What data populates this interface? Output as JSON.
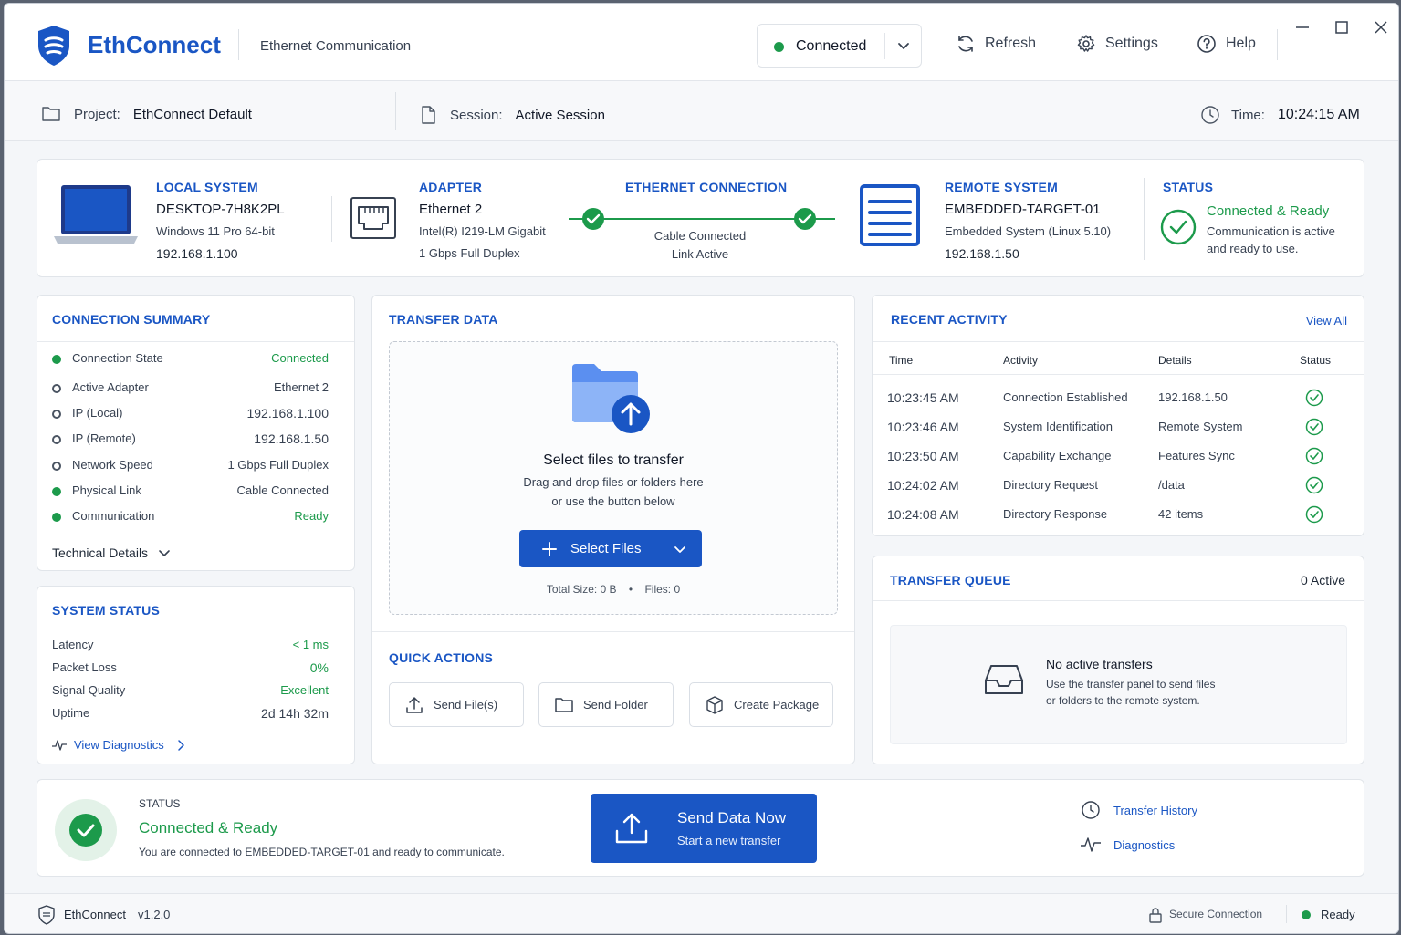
{
  "app": {
    "name": "EthConnect",
    "subtitle": "Ethernet Communication",
    "version": "v1.2.0"
  },
  "toolbar": {
    "connection_state": "Connected",
    "refresh": "Refresh",
    "settings": "Settings",
    "help": "Help"
  },
  "infobar": {
    "project_label": "Project:",
    "project": "EthConnect Default",
    "session_label": "Session:",
    "session": "Active Session",
    "time_label": "Time:",
    "time": "10:24:15 AM"
  },
  "overview": {
    "local": {
      "title": "LOCAL SYSTEM",
      "name": "DESKTOP-7H8K2PL",
      "os": "Windows 11 Pro 64-bit",
      "ip": "192.168.1.100"
    },
    "adapter": {
      "title": "ADAPTER",
      "name": "Ethernet 2",
      "model": "Intel(R) I219-LM Gigabit",
      "speed": "1 Gbps Full Duplex"
    },
    "link": {
      "title": "ETHERNET CONNECTION",
      "cable": "Cable Connected",
      "state": "Link Active"
    },
    "remote": {
      "title": "REMOTE SYSTEM",
      "name": "EMBEDDED-TARGET-01",
      "os": "Embedded System (Linux 5.10)",
      "ip": "192.168.1.50"
    },
    "status": {
      "title": "STATUS",
      "state": "Connected & Ready",
      "line1": "Communication is active",
      "line2": "and ready to use."
    }
  },
  "summary": {
    "title": "CONNECTION SUMMARY",
    "rows": [
      {
        "label": "Connection State",
        "value": "Connected"
      },
      {
        "label": "Active Adapter",
        "value": "Ethernet 2"
      },
      {
        "label": "IP (Local)",
        "value": "192.168.1.100"
      },
      {
        "label": "IP (Remote)",
        "value": "192.168.1.50"
      },
      {
        "label": "Network Speed",
        "value": "1 Gbps Full Duplex"
      },
      {
        "label": "Physical Link",
        "value": "Cable Connected"
      },
      {
        "label": "Communication",
        "value": "Ready"
      }
    ],
    "details_link": "Technical Details"
  },
  "system_status": {
    "title": "SYSTEM STATUS",
    "rows": [
      {
        "label": "Latency",
        "value": "< 1 ms"
      },
      {
        "label": "Packet Loss",
        "value": "0%"
      },
      {
        "label": "Signal Quality",
        "value": "Excellent"
      },
      {
        "label": "Uptime",
        "value": "2d 14h 32m"
      }
    ],
    "diagnostics_link": "View Diagnostics"
  },
  "transfer": {
    "title": "TRANSFER DATA",
    "heading": "Select files to transfer",
    "hint1": "Drag and drop files or folders here",
    "hint2": "or use the button below",
    "button": "Select Files",
    "total_size": "Total Size: 0 B",
    "files": "Files: 0"
  },
  "quick_actions": {
    "title": "QUICK ACTIONS",
    "send_files": "Send File(s)",
    "send_folder": "Send Folder",
    "create_package": "Create Package"
  },
  "activity": {
    "title": "RECENT ACTIVITY",
    "view_all": "View All",
    "headers": {
      "time": "Time",
      "activity": "Activity",
      "details": "Details",
      "status": "Status"
    },
    "rows": [
      {
        "time": "10:23:45 AM",
        "activity": "Connection Established",
        "details": "192.168.1.50"
      },
      {
        "time": "10:23:46 AM",
        "activity": "System Identification",
        "details": "Remote System"
      },
      {
        "time": "10:23:50 AM",
        "activity": "Capability Exchange",
        "details": "Features Sync"
      },
      {
        "time": "10:24:02 AM",
        "activity": "Directory Request",
        "details": "/data"
      },
      {
        "time": "10:24:08 AM",
        "activity": "Directory Response",
        "details": "42 items"
      }
    ]
  },
  "queue": {
    "title": "TRANSFER QUEUE",
    "count": "0 Active",
    "empty_title": "No active transfers",
    "empty_line1": "Use the transfer panel to send files",
    "empty_line2": "or folders to the remote system."
  },
  "footer_panel": {
    "label": "STATUS",
    "state": "Connected & Ready",
    "message": "You are connected to EMBEDDED-TARGET-01 and ready to communicate.",
    "send_title": "Send Data Now",
    "send_sub": "Start a new transfer",
    "history": "Transfer History",
    "diagnostics": "Diagnostics"
  },
  "statusbar": {
    "app": "EthConnect",
    "version": "v1.2.0",
    "secure": "Secure Connection",
    "ready": "Ready"
  },
  "colors": {
    "accent": "#1a56c4",
    "success": "#1c9a4b",
    "background": "#f4f6f9"
  }
}
